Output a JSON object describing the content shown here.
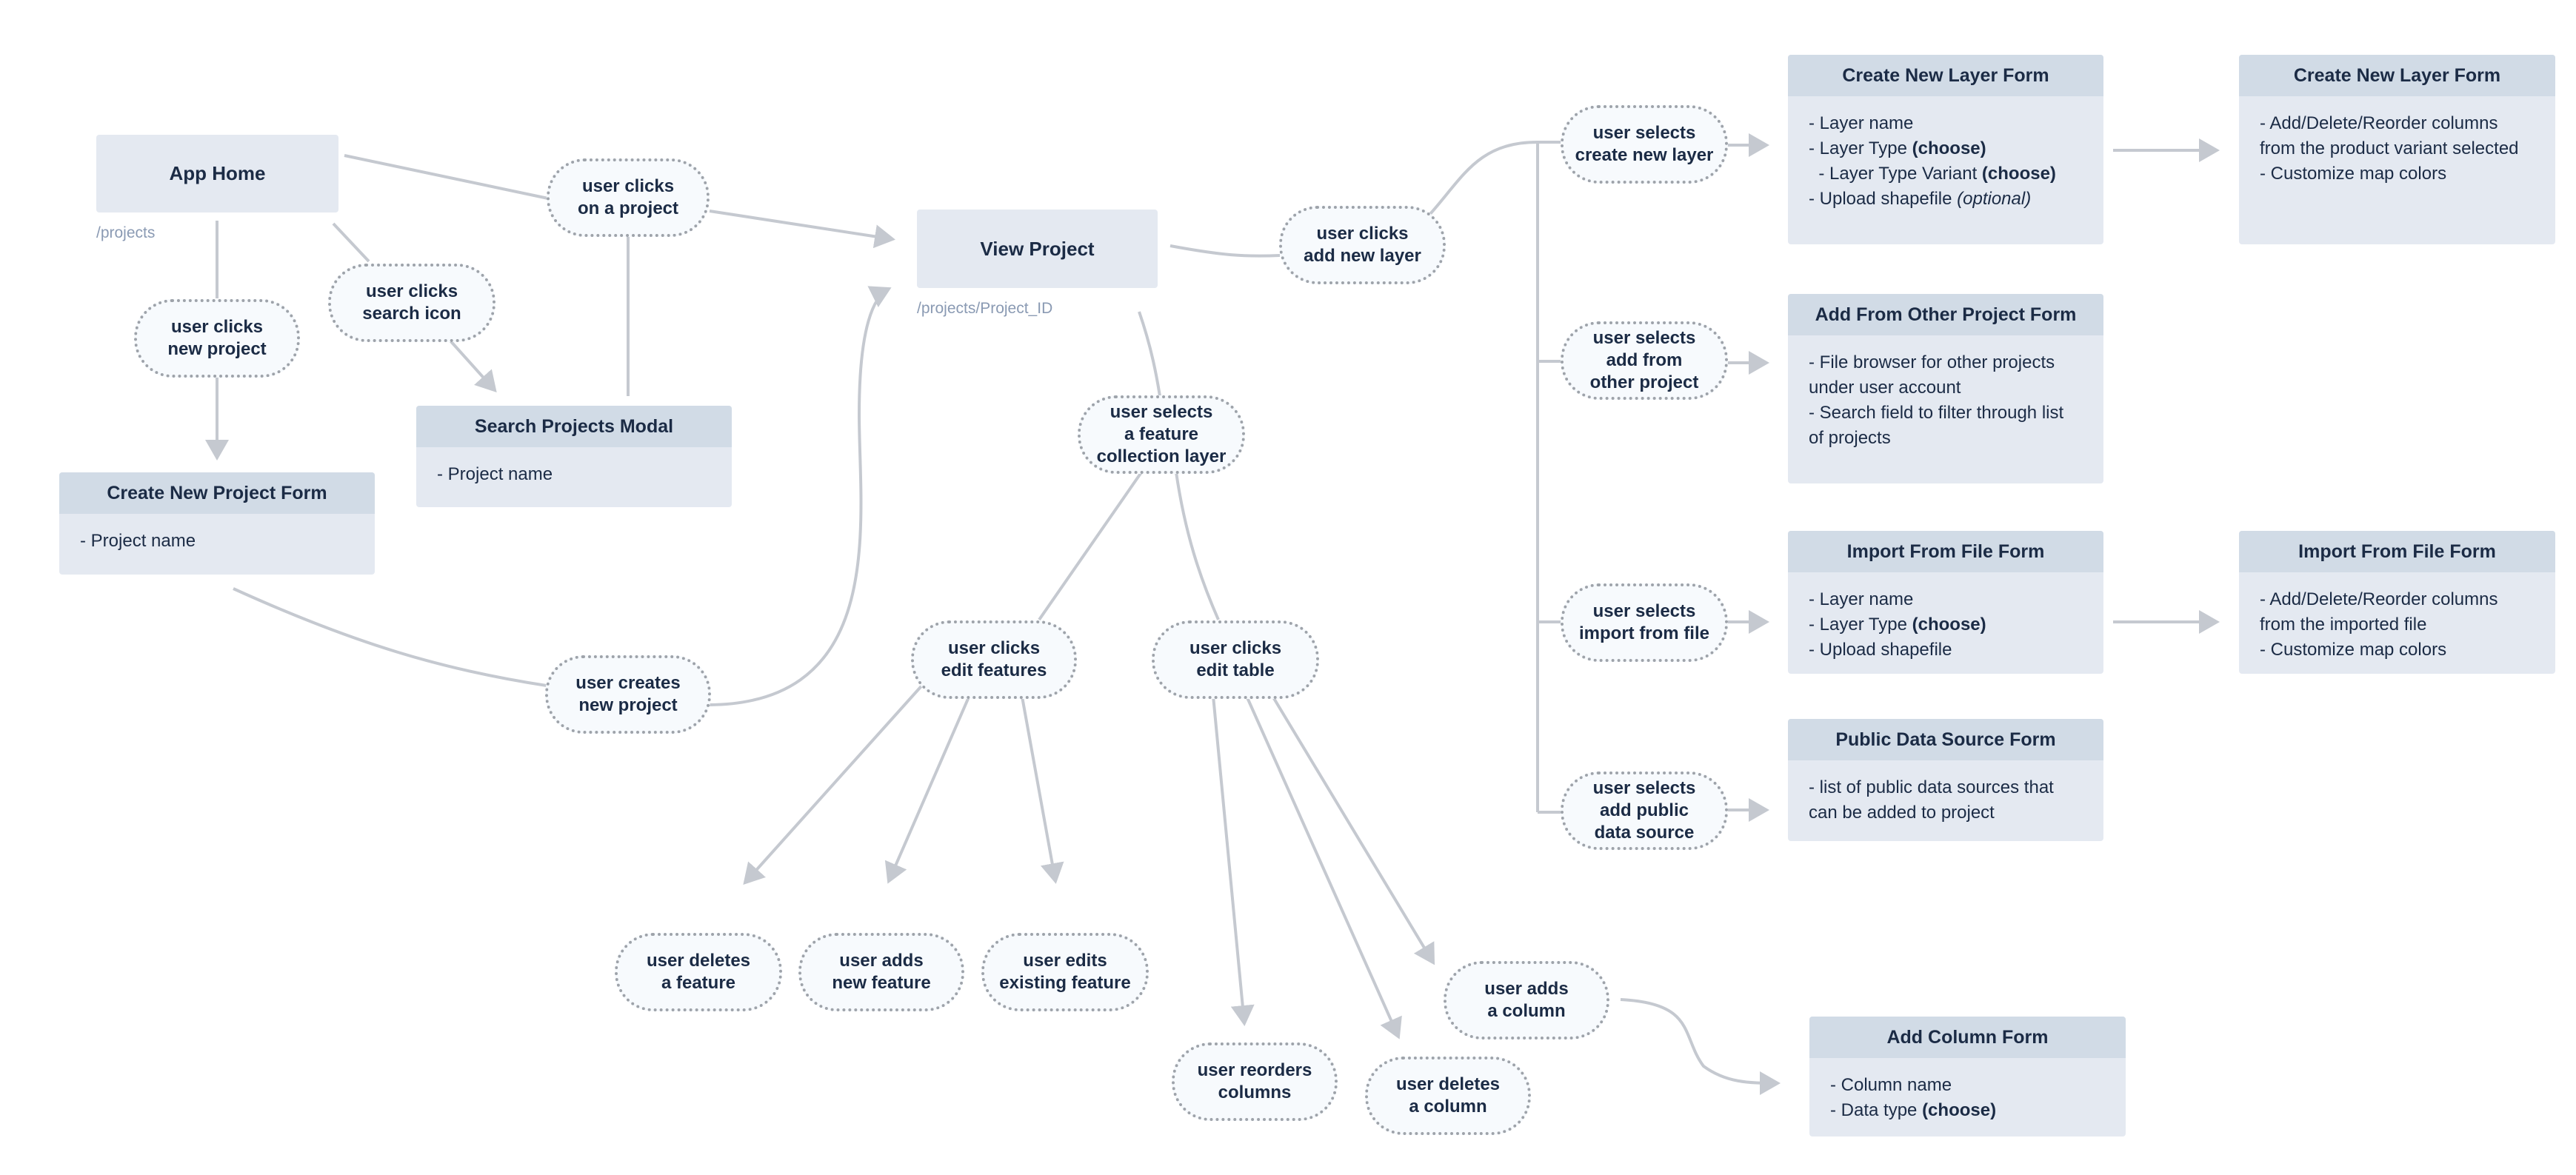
{
  "screens": {
    "app_home": {
      "title": "App Home",
      "route": "/projects"
    },
    "view_project": {
      "title": "View Project",
      "route": "/projects/Project_ID"
    }
  },
  "actions": {
    "clicks_on_project": "user clicks\non a project",
    "clicks_search_icon": "user clicks\nsearch icon",
    "clicks_new_project": "user clicks\nnew project",
    "creates_new_project": "user creates\nnew project",
    "clicks_add_new_layer": "user clicks\nadd new layer",
    "selects_feature_collection_layer": "user selects\na feature\ncollection layer",
    "clicks_edit_features": "user clicks\nedit features",
    "clicks_edit_table": "user clicks\nedit table",
    "deletes_feature": "user deletes\na feature",
    "adds_new_feature": "user adds\nnew feature",
    "edits_existing_feature": "user edits\nexisting feature",
    "reorders_columns": "user reorders\ncolumns",
    "deletes_column": "user deletes\na column",
    "adds_column": "user adds\na column",
    "selects_create_new_layer": "user selects\ncreate new layer",
    "selects_add_from_other_project": "user selects\nadd from\nother project",
    "selects_import_from_file": "user selects\nimport from file",
    "selects_add_public_data_source": "user selects\nadd public\ndata source"
  },
  "forms": {
    "search_projects_modal": {
      "title": "Search Projects Modal",
      "lines": [
        {
          "text": "- Project name"
        }
      ]
    },
    "create_new_project_form": {
      "title": "Create New Project Form",
      "lines": [
        {
          "text": "- Project name"
        }
      ]
    },
    "create_new_layer_form": {
      "title": "Create New Layer Form",
      "lines": [
        {
          "text": "- Layer name"
        },
        {
          "text": "- Layer Type ",
          "bold": "(choose)"
        },
        {
          "text": "  - Layer Type Variant ",
          "bold": "(choose)"
        },
        {
          "text": "- Upload shapefile ",
          "italic": "(optional)"
        }
      ]
    },
    "create_new_layer_form_step2": {
      "title": "Create New Layer Form",
      "lines": [
        {
          "text": "- Add/Delete/Reorder columns from the product variant selected"
        },
        {
          "text": "- Customize map colors"
        }
      ]
    },
    "add_from_other_project_form": {
      "title": "Add From Other Project Form",
      "lines": [
        {
          "text": "- File browser for other projects under user account"
        },
        {
          "text": "- Search field to filter through list of projects"
        }
      ]
    },
    "import_from_file_form": {
      "title": "Import From File Form",
      "lines": [
        {
          "text": "- Layer name"
        },
        {
          "text": "- Layer Type ",
          "bold": "(choose)"
        },
        {
          "text": "- Upload shapefile"
        }
      ]
    },
    "import_from_file_form_step2": {
      "title": "Import From File Form",
      "lines": [
        {
          "text": "- Add/Delete/Reorder columns from the imported file"
        },
        {
          "text": "- Customize map colors"
        }
      ]
    },
    "public_data_source_form": {
      "title": "Public Data Source Form",
      "lines": [
        {
          "text": "- list of public data sources that can be added to project"
        }
      ]
    },
    "add_column_form": {
      "title": "Add Column Form",
      "lines": [
        {
          "text": "- Column name"
        },
        {
          "text": "- Data type ",
          "bold": "(choose)"
        }
      ]
    }
  },
  "colors": {
    "screen_fill": "#e4e9f1",
    "form_header": "#d1dbe6",
    "pill_fill": "#f7fafd",
    "pill_border": "#9ea3aa",
    "edge": "#c5c9d0",
    "text": "#1b2b45",
    "route_text": "#8a9ab3"
  }
}
